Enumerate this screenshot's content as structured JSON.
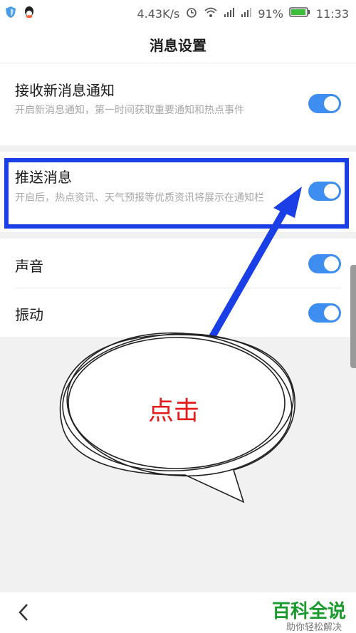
{
  "status_bar": {
    "speed": "4.43K/s",
    "battery": "91%",
    "time": "11:33",
    "icons": [
      "shield-app-icon",
      "qq-icon",
      "alarm-icon",
      "wifi-icon",
      "signal-icon",
      "signal-icon",
      "battery-icon"
    ]
  },
  "header": {
    "title": "消息设置"
  },
  "settings": {
    "receive": {
      "title": "接收新消息通知",
      "desc": "开启新消息通知，第一时间获取重要通知和热点事件",
      "enabled": true
    },
    "push": {
      "title": "推送消息",
      "desc": "开启后，热点资讯、天气预报等优质资讯将展示在通知栏",
      "enabled": true
    },
    "sound": {
      "title": "声音",
      "enabled": true
    },
    "vibrate": {
      "title": "振动",
      "enabled": true
    }
  },
  "annotation": {
    "callout_text": "点击",
    "colors": {
      "box": "#1b3fe6",
      "text": "#e51c1c"
    }
  },
  "footer": {
    "back_icon": "chevron-left-icon"
  },
  "watermark": {
    "main": "百科全说",
    "sub": "助你轻松解决"
  },
  "colors": {
    "toggle_on": "#3d8ef0",
    "background": "#f1f1f1"
  }
}
